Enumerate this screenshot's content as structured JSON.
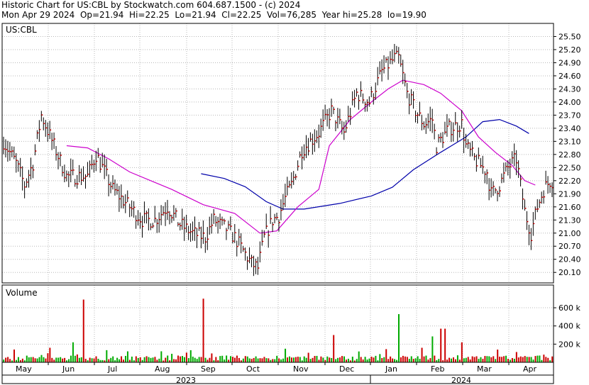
{
  "header": {
    "line1": "Historic Chart for US:CBL by Stockwatch.com 604.687.1500 - (c) 2024",
    "line2": "Mon Apr 29 2024  Op=21.94  Hi=22.25  Lo=21.94  Cl=22.25  Vol=76,285  Year hi=25.28  lo=19.90"
  },
  "chart_data": [
    {
      "type": "line",
      "name": "price-panel",
      "label": "US:CBL",
      "price_ticks": [
        "25.50",
        "25.20",
        "24.90",
        "24.60",
        "24.30",
        "24.00",
        "23.70",
        "23.40",
        "23.10",
        "22.80",
        "22.50",
        "22.20",
        "21.90",
        "21.60",
        "21.30",
        "21.00",
        "20.70",
        "20.40",
        "20.10"
      ],
      "ylim": [
        19.86,
        25.8
      ],
      "months": [
        "May",
        "Jun",
        "Jul",
        "Aug",
        "Sep",
        "Oct",
        "Nov",
        "Dec",
        "Jan",
        "Feb",
        "Mar",
        "Apr"
      ],
      "years": [
        "2023",
        "2024"
      ],
      "price_anchors": [
        [
          0,
          23.1
        ],
        [
          6,
          22.6
        ],
        [
          10,
          22.1
        ],
        [
          14,
          22.6
        ],
        [
          18,
          23.7
        ],
        [
          24,
          23.0
        ],
        [
          30,
          22.3
        ],
        [
          40,
          22.3
        ],
        [
          44,
          22.8
        ],
        [
          52,
          22.0
        ],
        [
          60,
          21.6
        ],
        [
          66,
          21.3
        ],
        [
          72,
          21.3
        ],
        [
          78,
          21.6
        ],
        [
          84,
          21.2
        ],
        [
          90,
          21.0
        ],
        [
          96,
          20.9
        ],
        [
          100,
          21.3
        ],
        [
          106,
          21.1
        ],
        [
          110,
          20.9
        ],
        [
          114,
          20.6
        ],
        [
          118,
          20.3
        ],
        [
          121,
          20.2
        ],
        [
          124,
          20.9
        ],
        [
          128,
          21.3
        ],
        [
          131,
          21.4
        ],
        [
          134,
          21.8
        ],
        [
          137,
          22.1
        ],
        [
          142,
          22.9
        ],
        [
          150,
          23.3
        ],
        [
          156,
          23.8
        ],
        [
          162,
          23.3
        ],
        [
          168,
          24.2
        ],
        [
          174,
          24.0
        ],
        [
          180,
          24.7
        ],
        [
          186,
          25.0
        ],
        [
          188,
          25.0
        ],
        [
          192,
          24.2
        ],
        [
          196,
          23.8
        ],
        [
          200,
          23.5
        ],
        [
          204,
          23.6
        ],
        [
          206,
          23.0
        ],
        [
          212,
          23.4
        ],
        [
          218,
          23.5
        ],
        [
          220,
          23.0
        ],
        [
          224,
          22.7
        ],
        [
          230,
          22.4
        ],
        [
          232,
          21.9
        ],
        [
          236,
          22.1
        ],
        [
          240,
          22.5
        ],
        [
          244,
          22.7
        ],
        [
          248,
          21.5
        ],
        [
          251,
          21.0
        ],
        [
          254,
          21.6
        ],
        [
          257,
          22.0
        ],
        [
          260,
          22.2
        ]
      ],
      "series": [
        {
          "name": "moving-average-long",
          "color": "#0000aa",
          "points": [
            [
              94,
              22.36
            ],
            [
              105,
              22.25
            ],
            [
              115,
              22.06
            ],
            [
              125,
              21.72
            ],
            [
              133,
              21.55
            ],
            [
              143,
              21.55
            ],
            [
              160,
              21.68
            ],
            [
              175,
              21.85
            ],
            [
              185,
              22.05
            ],
            [
              195,
              22.45
            ],
            [
              208,
              22.85
            ],
            [
              220,
              23.2
            ],
            [
              228,
              23.55
            ],
            [
              236,
              23.6
            ],
            [
              244,
              23.45
            ],
            [
              250,
              23.28
            ]
          ]
        },
        {
          "name": "moving-average-short",
          "color": "#cc00cc",
          "points": [
            [
              30,
              23.0
            ],
            [
              40,
              22.95
            ],
            [
              50,
              22.7
            ],
            [
              60,
              22.4
            ],
            [
              70,
              22.2
            ],
            [
              80,
              22.0
            ],
            [
              95,
              21.65
            ],
            [
              110,
              21.45
            ],
            [
              122,
              21.0
            ],
            [
              130,
              21.05
            ],
            [
              140,
              21.6
            ],
            [
              150,
              22.0
            ],
            [
              155,
              23.0
            ],
            [
              165,
              23.6
            ],
            [
              175,
              24.0
            ],
            [
              183,
              24.3
            ],
            [
              190,
              24.5
            ],
            [
              200,
              24.4
            ],
            [
              208,
              24.2
            ],
            [
              218,
              23.8
            ],
            [
              226,
              23.2
            ],
            [
              234,
              22.85
            ],
            [
              242,
              22.55
            ],
            [
              248,
              22.2
            ],
            [
              253,
              22.1
            ]
          ]
        }
      ]
    },
    {
      "type": "bar",
      "name": "volume-panel",
      "label": "Volume",
      "volume_ticks": [
        "600 k",
        "400 k",
        "200 k"
      ],
      "ylim": [
        0,
        850
      ],
      "unit": "k",
      "spikes": [
        {
          "index": 38,
          "value": 690,
          "color": "#cc0000"
        },
        {
          "index": 95,
          "value": 700,
          "color": "#cc0000"
        },
        {
          "index": 188,
          "value": 530,
          "color": "#00aa00"
        },
        {
          "index": 157,
          "value": 300,
          "color": "#cc0000"
        },
        {
          "index": 204,
          "value": 285,
          "color": "#00aa00"
        },
        {
          "index": 208,
          "value": 370,
          "color": "#cc0000"
        },
        {
          "index": 210,
          "value": 370,
          "color": "#cc0000"
        },
        {
          "index": 218,
          "value": 220,
          "color": "#cc0000"
        },
        {
          "index": 33,
          "value": 220,
          "color": "#00aa00"
        },
        {
          "index": 22,
          "value": 160,
          "color": "#cc0000"
        },
        {
          "index": 199,
          "value": 160,
          "color": "#cc0000"
        },
        {
          "index": 235,
          "value": 140,
          "color": "#cc0000"
        }
      ]
    }
  ]
}
